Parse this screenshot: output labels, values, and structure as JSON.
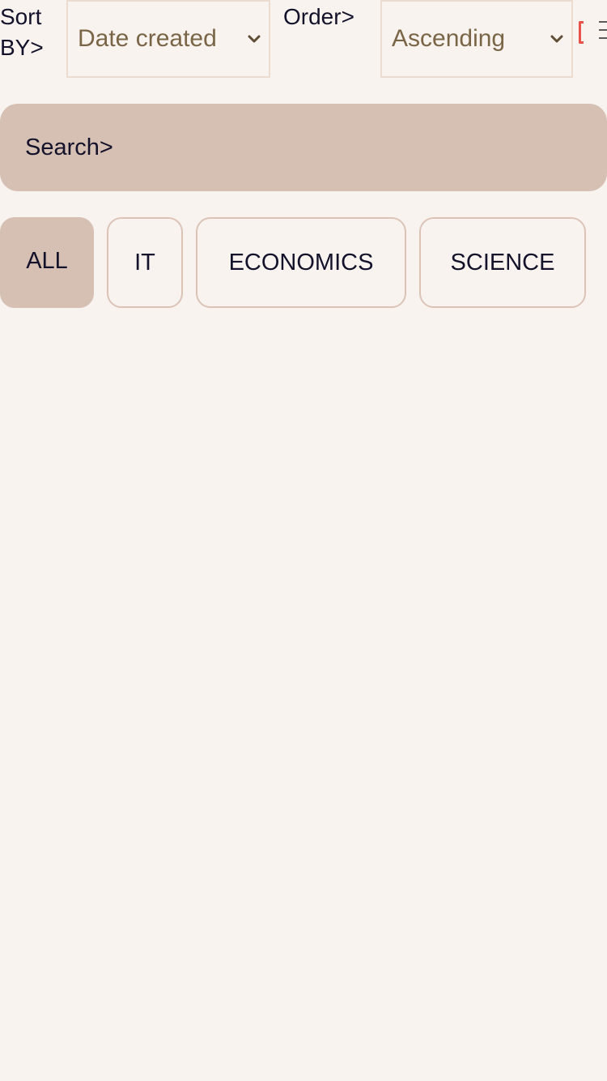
{
  "toolbar": {
    "sort_label": "Sort\nBY>",
    "sort_value": "Date created",
    "order_label": "Order>",
    "order_value": "Ascending"
  },
  "search": {
    "placeholder": "Search>"
  },
  "categories": [
    {
      "label": "ALL",
      "active": true
    },
    {
      "label": "IT",
      "active": false
    },
    {
      "label": "ECONOMICS",
      "active": false
    },
    {
      "label": "SCIENCE",
      "active": false
    }
  ],
  "icons": {
    "chevron": "chevron-down-icon",
    "partial_left": "red-bracket-icon",
    "menu": "menu-icon"
  },
  "colors": {
    "background": "#f8f3ef",
    "accent": "#d5c0b3",
    "text": "#14122b",
    "select_text": "#7a6546",
    "border": "#ecdcd0",
    "alert": "#e8524a"
  }
}
